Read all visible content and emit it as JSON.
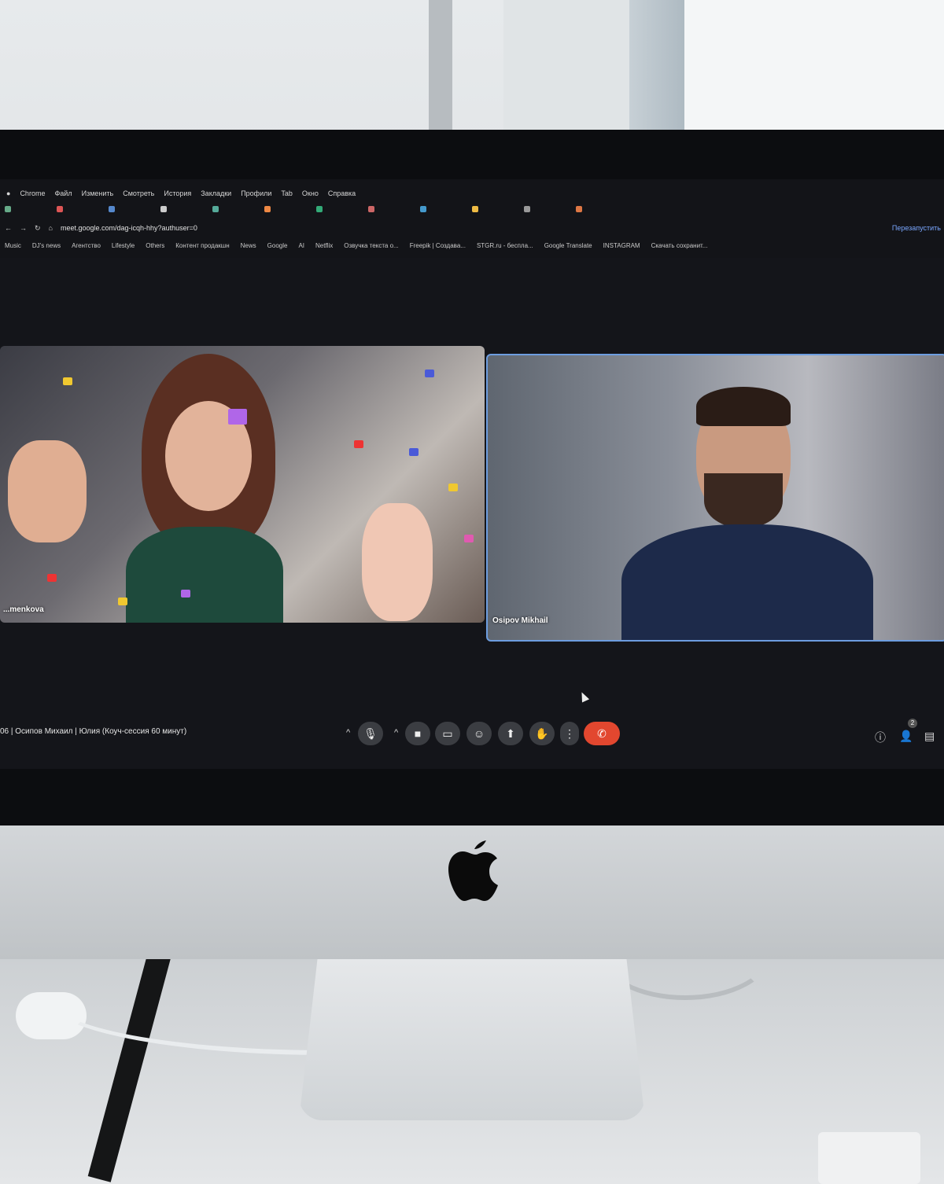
{
  "browser": {
    "menu": [
      "Chrome",
      "Файл",
      "Изменить",
      "Смотреть",
      "История",
      "Закладки",
      "Профили",
      "Tab",
      "Окно",
      "Справка"
    ],
    "url": "meet.google.com/dag-icqh-hhy?authuser=0",
    "bookmarks": [
      "Music",
      "DJ's news",
      "Агентство",
      "Lifestyle",
      "Others",
      "Контент продакшн",
      "News",
      "Google",
      "AI",
      "Netflix",
      "Озвучка текста о...",
      "Freepik | Создава...",
      "STGR.ru - беспла...",
      "Google Translate",
      "INSTAGRAM",
      "Скачать сохранит..."
    ],
    "relaunch": "Перезапустить"
  },
  "meet": {
    "left_participant_label": "...menkova",
    "right_participant_label": "Osipov Mikhail",
    "meeting_title": "06  |  Осипов Михаил | Юлия (Коуч-сессия 60 минут)",
    "participants_count": "2"
  },
  "icons": {
    "mic": "microphone-icon",
    "camera": "camera-icon",
    "captions": "captions-icon",
    "emoji": "emoji-icon",
    "present": "present-icon",
    "hand": "raise-hand-icon",
    "more": "more-vert-icon",
    "end": "end-call-icon",
    "info": "info-icon",
    "people": "people-icon",
    "chat": "chat-icon"
  },
  "colors": {
    "end_call": "#e2472f",
    "active_speaker_border": "#6d9de0",
    "screen_bg": "#14151a"
  }
}
